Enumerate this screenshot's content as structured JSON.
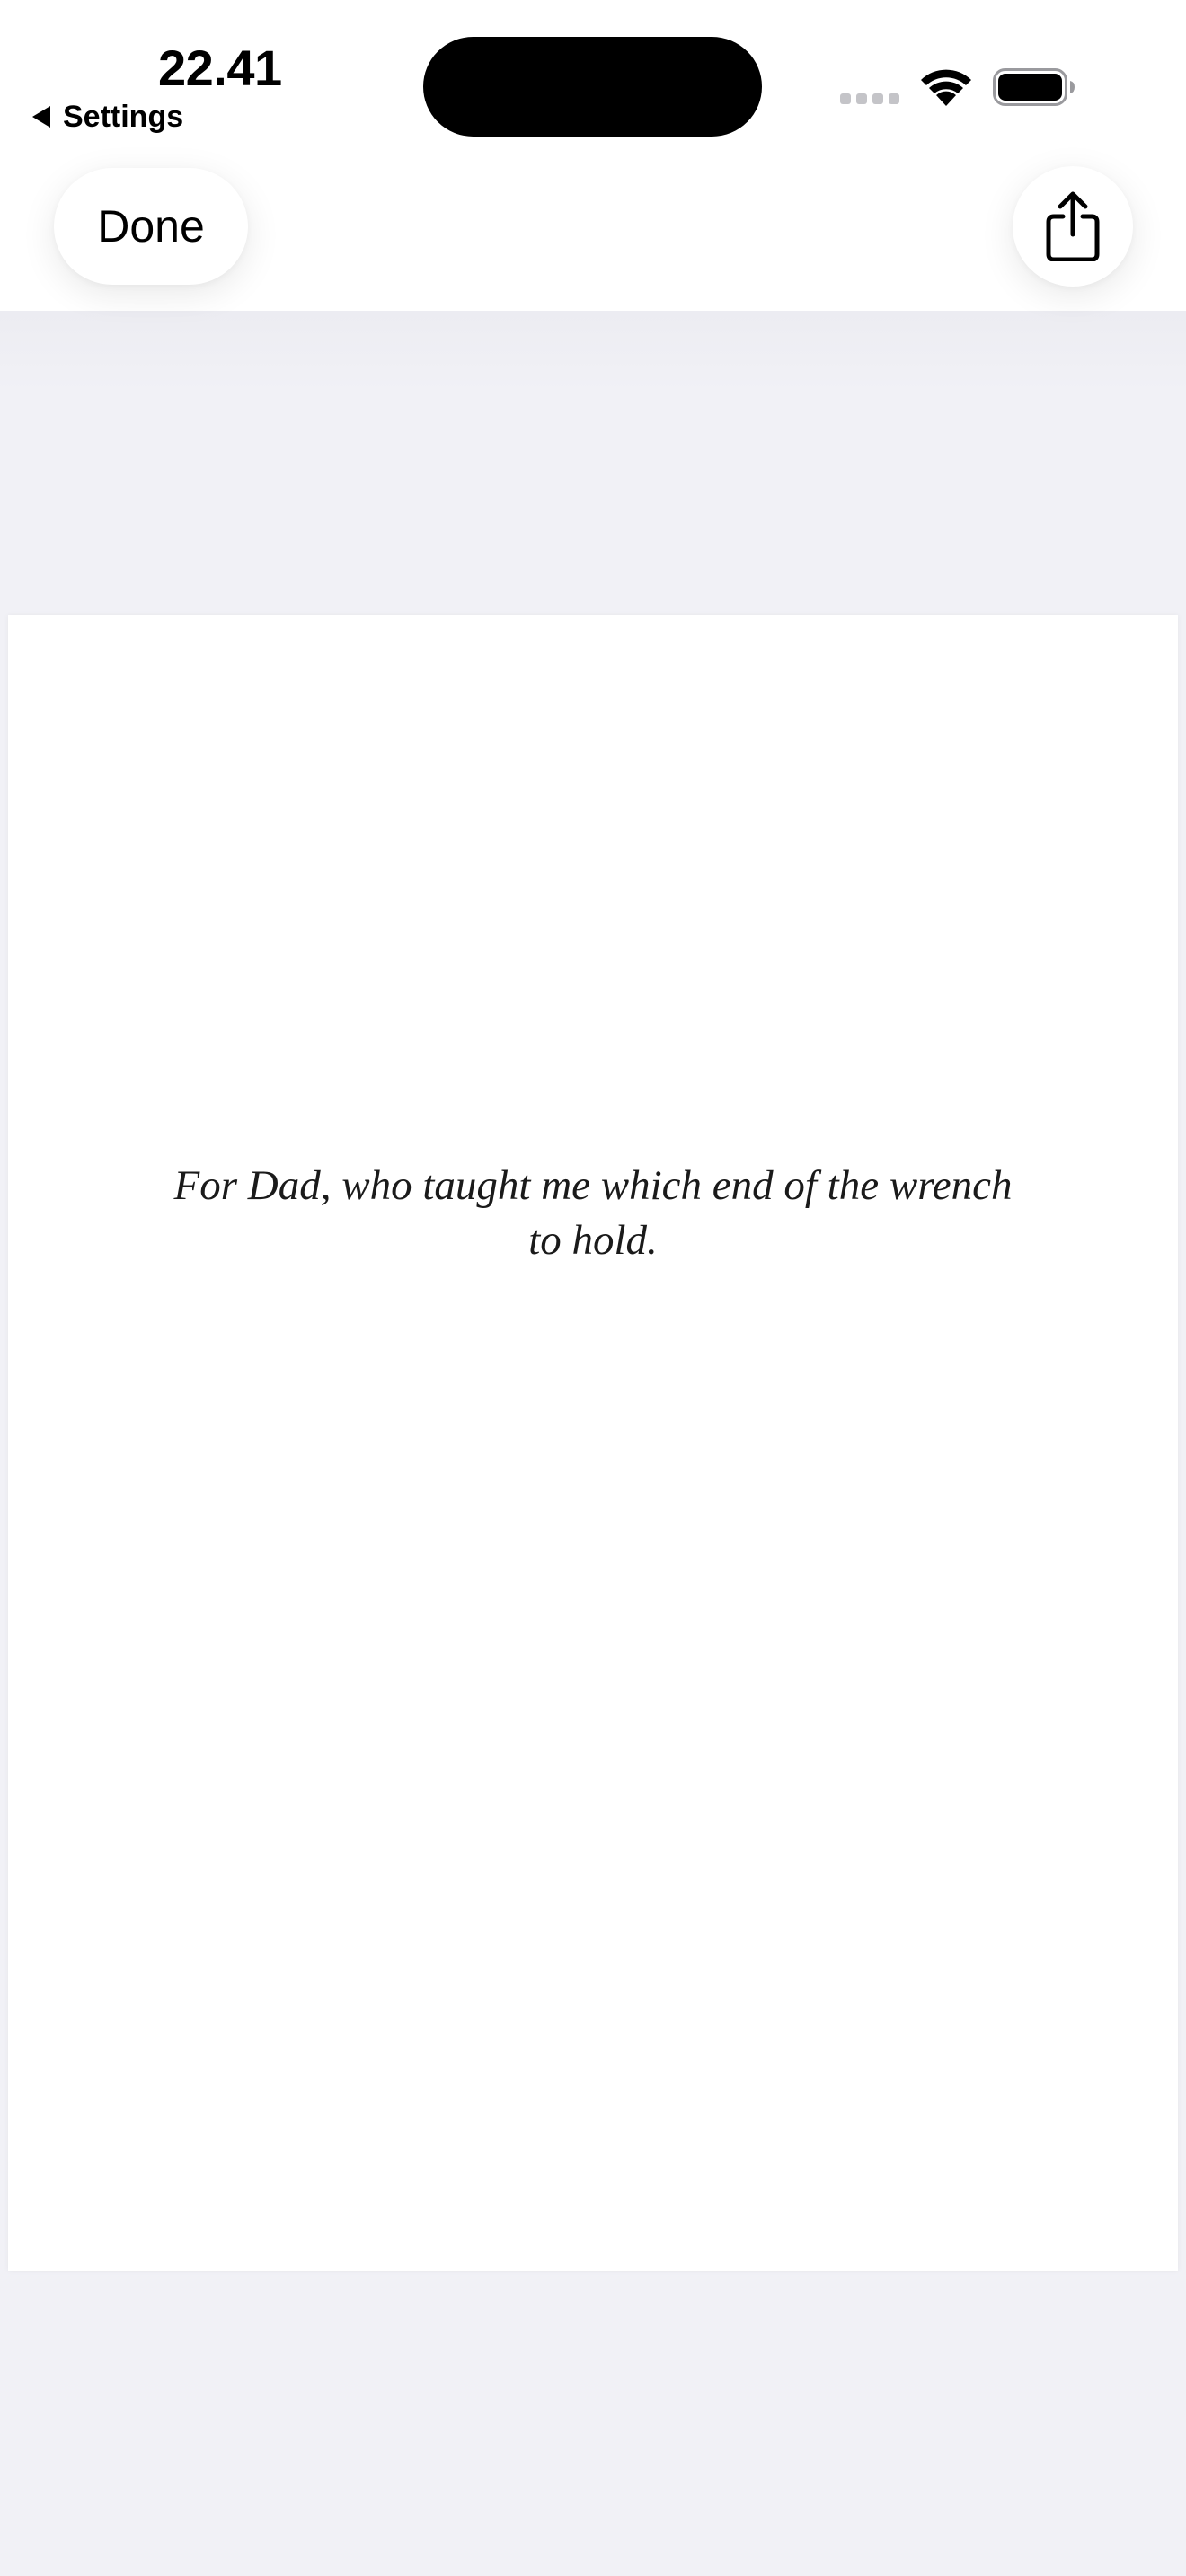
{
  "status_bar": {
    "time": "22.41",
    "back_app": "Settings",
    "icons": [
      "cellular-signal-icon",
      "wifi-icon",
      "battery-icon"
    ]
  },
  "toolbar": {
    "done_label": "Done",
    "share_icon": "share-icon"
  },
  "document": {
    "dedication": "For Dad, who taught me which end of the wrench to hold."
  },
  "colors": {
    "background": "#f1f1f6",
    "page": "#ffffff",
    "text": "#1a1a1a"
  }
}
